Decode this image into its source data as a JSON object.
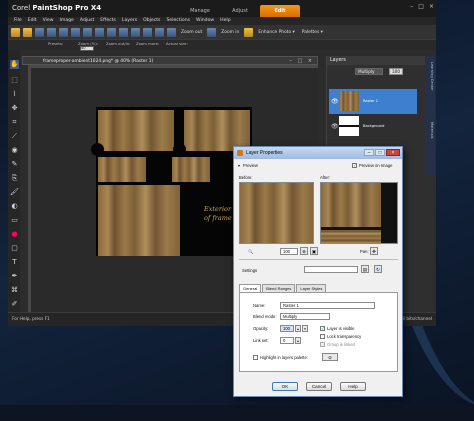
{
  "app": {
    "brand": "Corel",
    "product": "PaintShop Pro X4",
    "workspace_tabs": [
      "Manage",
      "Adjust",
      "Edit"
    ],
    "active_tab": "Edit",
    "window_controls": [
      "–",
      "□",
      "×"
    ]
  },
  "menu": [
    "File",
    "Edit",
    "View",
    "Image",
    "Adjust",
    "Effects",
    "Layers",
    "Objects",
    "Selections",
    "Window",
    "Help"
  ],
  "toolbar": {
    "zoom_out": "Zoom out",
    "zoom_in": "Zoom in",
    "enhance_photo": "Enhance Photo ▾",
    "palettes": "Palettes ▾"
  },
  "optionbar": {
    "labels": [
      "Presets:",
      "Zoom (%):",
      "Zoom out/in:",
      "Zoom more:",
      "Actual size:"
    ],
    "zoom_value": "40"
  },
  "document": {
    "title": "frameproper-ambient1024.png* @ 40% (Raster 1)",
    "doc_buttons": "– □ ×",
    "caption_line1": "Exterior",
    "caption_line2": "of frame"
  },
  "layers_panel": {
    "title": "Layers",
    "blend": "Multiply",
    "opacity": "100",
    "layers": [
      {
        "name": "Raster 1",
        "selected": true
      },
      {
        "name": "Background",
        "selected": false
      }
    ],
    "side_tabs": [
      "Learning Center",
      "Materials"
    ]
  },
  "status": {
    "left": "For Help, press F1",
    "right": "Raster 1: Image 8x: 1024 x 1024 x RGB - 8 bits/channel"
  },
  "dialog": {
    "title": "Layer Properties",
    "preview_label": "Preview",
    "preview_on_image": "Preview on Image",
    "before": "Before:",
    "after": "After:",
    "zoom_value": "100",
    "pan_label": "Pan:",
    "settings_label": "Settings",
    "tabs": [
      "General",
      "Blend Ranges",
      "Layer Styles"
    ],
    "active_tab": "General",
    "name_label": "Name:",
    "name_value": "Raster 1",
    "blend_label": "Blend mode:",
    "blend_value": "Multiply",
    "opacity_label": "Opacity:",
    "opacity_value": "100",
    "visible": "Layer is visible",
    "lock": "Lock transparency",
    "group": "Group is linked",
    "link_label": "Link set:",
    "link_value": "0",
    "highlight": "Highlight in layers palette:",
    "ok": "OK",
    "cancel": "Cancel",
    "help": "Help"
  }
}
